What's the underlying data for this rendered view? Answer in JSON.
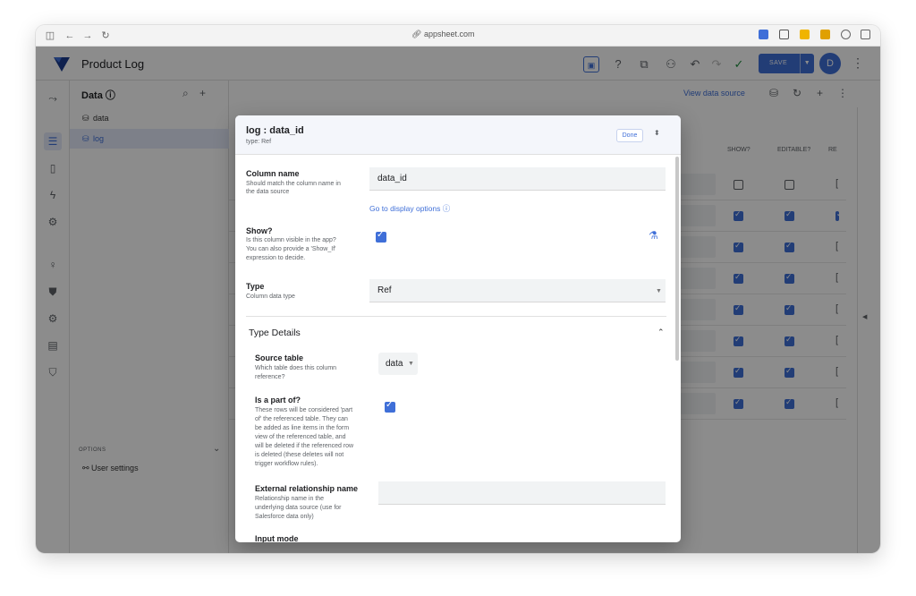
{
  "browser": {
    "url": "appsheet.com",
    "icons": [
      "sidebar-icon",
      "back-icon",
      "forward-icon",
      "reload-icon",
      "link-icon"
    ]
  },
  "appbar": {
    "title": "Product Log",
    "save_label": "SAVE",
    "avatar_initial": "D"
  },
  "data_panel": {
    "title": "Data ⓘ",
    "items": [
      {
        "label": "data",
        "icon": "database-icon"
      },
      {
        "label": "log",
        "icon": "database-icon"
      }
    ],
    "options_label": "OPTIONS",
    "user_settings": "User settings"
  },
  "main": {
    "view_data_source": "View data source",
    "columns": [
      "SHOW?",
      "EDITABLE?",
      "RE"
    ],
    "rows": [
      {
        "show": false,
        "editable": false,
        "req": "["
      },
      {
        "show": true,
        "editable": true,
        "req": "checked"
      },
      {
        "show": true,
        "editable": true,
        "req": "["
      },
      {
        "show": true,
        "editable": true,
        "req": "["
      },
      {
        "show": true,
        "editable": true,
        "req": "["
      },
      {
        "show": true,
        "editable": true,
        "req": "["
      },
      {
        "show": true,
        "editable": true,
        "req": "["
      },
      {
        "show": true,
        "editable": true,
        "req": "["
      }
    ]
  },
  "dialog": {
    "title": "log : data_id",
    "subtitle": "type: Ref",
    "done_label": "Done",
    "column_name": {
      "label": "Column name",
      "desc": [
        "Should match the column name in",
        "the data source"
      ],
      "value": "data_id",
      "link": "Go to display options ⓘ"
    },
    "show": {
      "label": "Show?",
      "desc": [
        "Is this column visible in the app?",
        "You can also provide a 'Show_If'",
        "expression to decide."
      ],
      "checked": true
    },
    "type": {
      "label": "Type",
      "desc": [
        "Column data type"
      ],
      "value": "Ref"
    },
    "type_details": {
      "title": "Type Details",
      "source_table": {
        "label": "Source table",
        "desc": [
          "Which table does this column",
          "reference?"
        ],
        "value": "data"
      },
      "is_part_of": {
        "label": "Is a part of?",
        "desc": [
          "These rows will be considered 'part",
          "of' the referenced table. They can",
          "be added as line items in the form",
          "view of the referenced table, and",
          "will be deleted if the referenced row",
          "is deleted (these deletes will not",
          "trigger workflow rules)."
        ],
        "checked": true
      },
      "external_rel": {
        "label": "External relationship name",
        "desc": [
          "Relationship name in the",
          "underlying data source (use for",
          "Salesforce data only)"
        ],
        "value": ""
      },
      "input_mode": {
        "label": "Input mode"
      }
    }
  }
}
